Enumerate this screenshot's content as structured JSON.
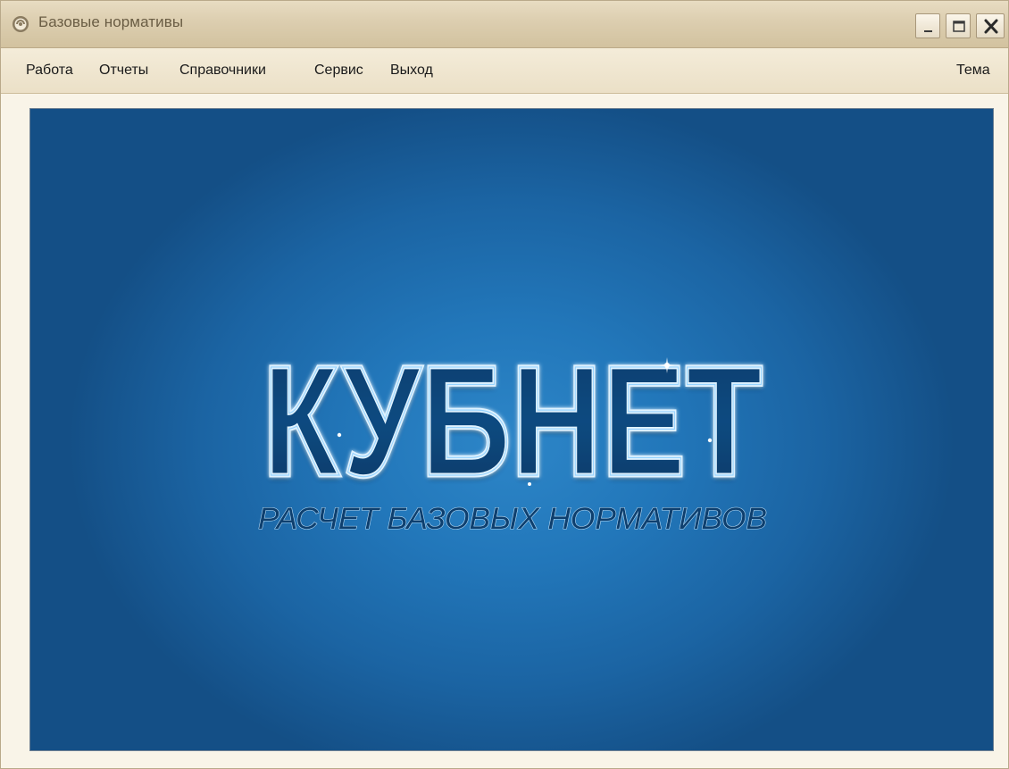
{
  "window": {
    "title": "Базовые нормативы"
  },
  "menu": {
    "items": [
      "Работа",
      "Отчеты",
      "Справочники",
      "Сервис",
      "Выход"
    ],
    "right_item": "Тема"
  },
  "splash": {
    "logo_text": "КУБНЕТ",
    "subtitle": "РАСЧЕТ БАЗОВЫХ НОРМАТИВОВ",
    "background_color": "#2277ba"
  },
  "icons": {
    "app": "app-logo-icon",
    "minimize": "minimize-icon",
    "maximize": "maximize-icon",
    "close": "close-icon"
  }
}
